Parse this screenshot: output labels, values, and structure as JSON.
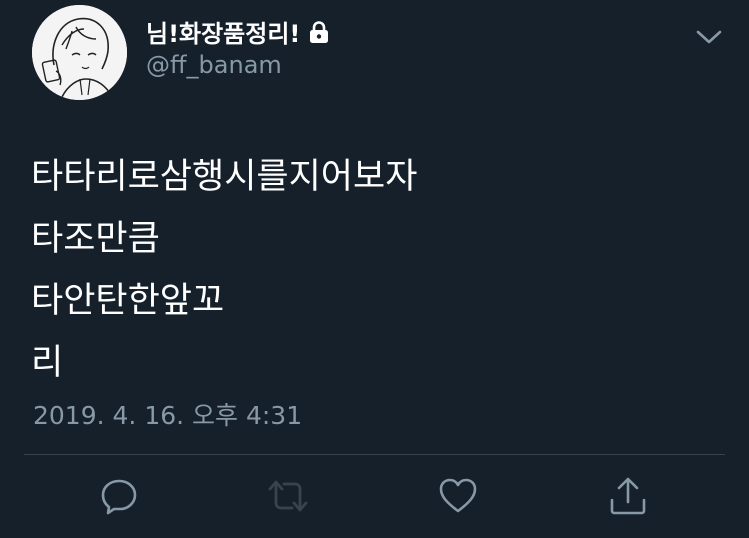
{
  "tweet": {
    "author": {
      "display_name": "님!화장품정리!",
      "handle": "@ff_banam",
      "protected_icon": "lock-icon"
    },
    "text_lines": [
      "타타리로삼행시를지어보자",
      "타조만큼",
      "타안탄한앞꼬",
      "리"
    ],
    "timestamp": "2019. 4. 16. 오후 4:31",
    "actions": {
      "reply_icon": "comment-icon",
      "retweet_icon": "retweet-icon",
      "like_icon": "heart-icon",
      "share_icon": "share-icon"
    },
    "menu_icon": "chevron-down-icon"
  },
  "colors": {
    "background": "#15202b",
    "primary_text": "#ffffff",
    "secondary_text": "#8899a6",
    "divider": "#38444d"
  }
}
